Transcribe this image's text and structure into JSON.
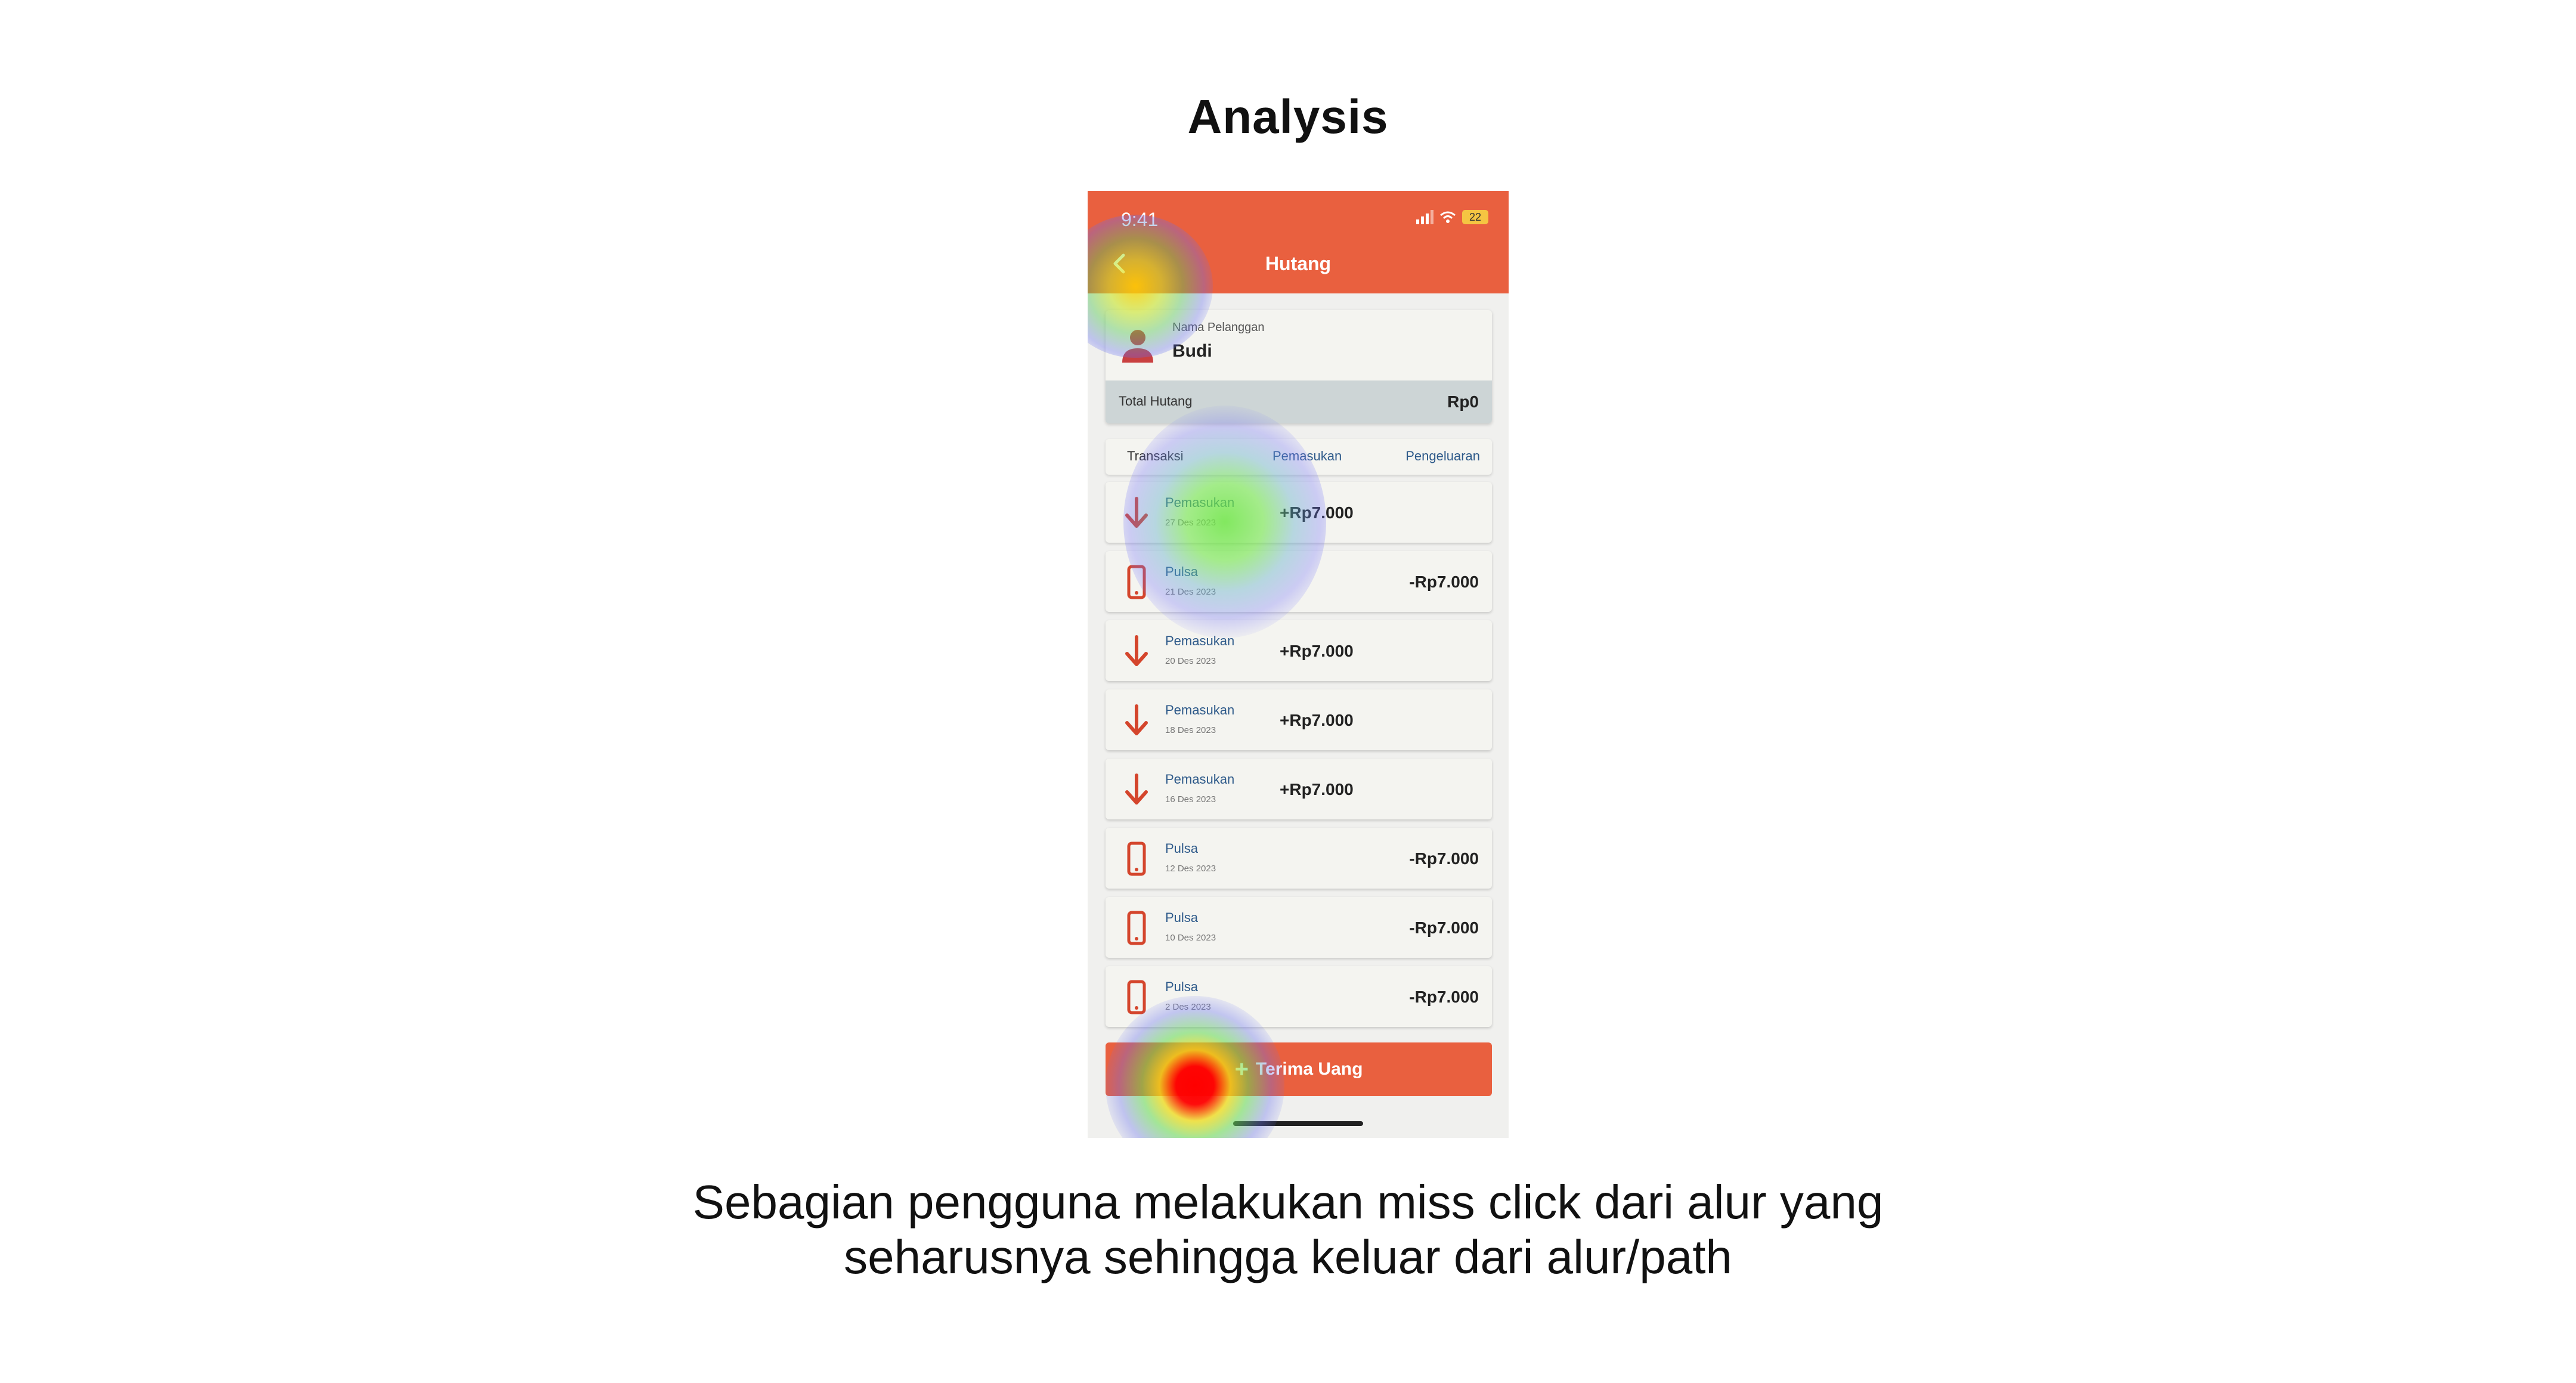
{
  "slide": {
    "title": "Analysis",
    "caption_line1": "Sebagian pengguna melakukan miss click dari alur yang",
    "caption_line2": "seharusnya sehingga keluar dari alur/path"
  },
  "phone": {
    "status_time": "9:41",
    "battery": "22",
    "appbar_title": "Hutang",
    "customer": {
      "label": "Nama Pelanggan",
      "name": "Budi",
      "total_label": "Total Hutang",
      "total_value": "Rp0"
    },
    "table_header": {
      "transaksi": "Transaksi",
      "pemasukan": "Pemasukan",
      "pengeluaran": "Pengeluaran"
    },
    "transactions": [
      {
        "title": "Pemasukan",
        "date": "27 Des 2023",
        "amount": "+Rp7.000",
        "type": "in"
      },
      {
        "title": "Pulsa",
        "date": "21 Des 2023",
        "amount": "-Rp7.000",
        "type": "out"
      },
      {
        "title": "Pemasukan",
        "date": "20 Des 2023",
        "amount": "+Rp7.000",
        "type": "in"
      },
      {
        "title": "Pemasukan",
        "date": "18 Des 2023",
        "amount": "+Rp7.000",
        "type": "in"
      },
      {
        "title": "Pemasukan",
        "date": "16 Des 2023",
        "amount": "+Rp7.000",
        "type": "in"
      },
      {
        "title": "Pulsa",
        "date": "12 Des 2023",
        "amount": "-Rp7.000",
        "type": "out"
      },
      {
        "title": "Pulsa",
        "date": "10 Des 2023",
        "amount": "-Rp7.000",
        "type": "out"
      },
      {
        "title": "Pulsa",
        "date": "2 Des 2023",
        "amount": "-Rp7.000",
        "type": "out"
      }
    ],
    "cta_label": "Terima Uang",
    "colors": {
      "accent": "#e9603f",
      "link_text": "#2e5a8a",
      "total_bar": "#cdd5d6"
    }
  }
}
